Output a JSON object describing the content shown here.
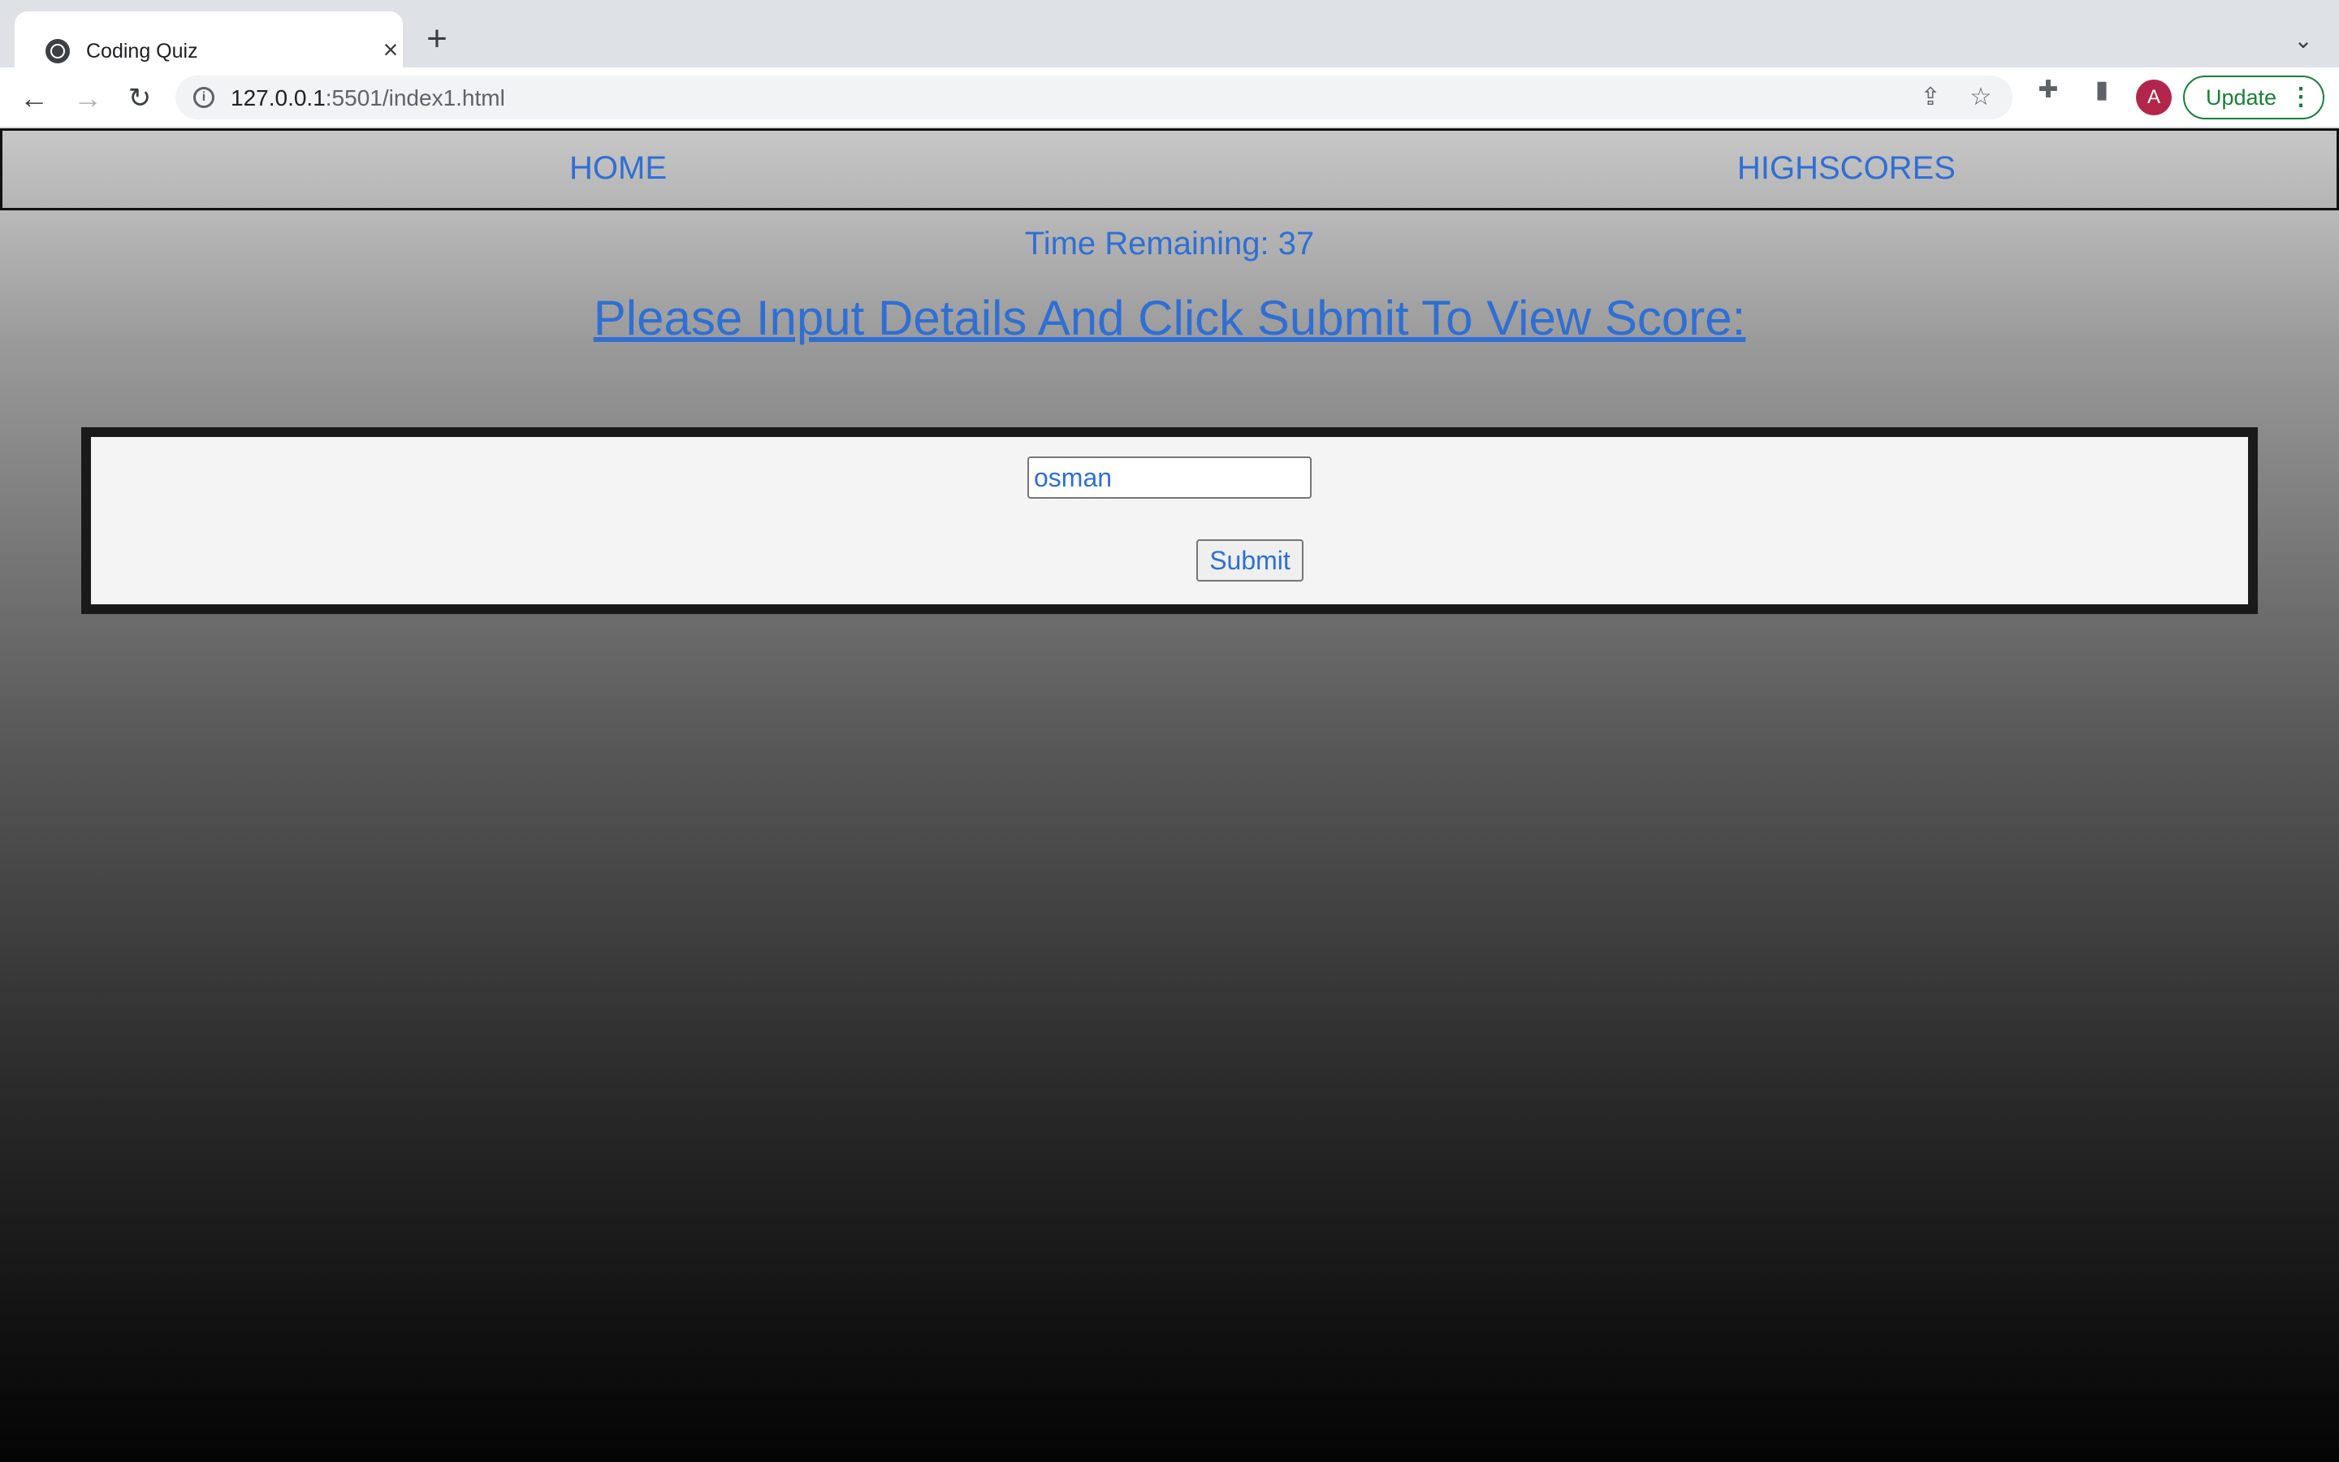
{
  "browser": {
    "tab_title": "Coding Quiz",
    "url_host": "127.0.0.1",
    "url_rest": ":5501/index1.html",
    "avatar_letter": "A",
    "update_label": "Update",
    "icons": {
      "favicon": "globe-icon",
      "close": "close-icon",
      "new_tab": "plus-icon",
      "tab_search": "chevron-down-icon",
      "back": "back-arrow-icon",
      "forward": "forward-arrow-icon",
      "reload": "reload-icon",
      "site_info": "info-icon",
      "share": "share-icon",
      "bookmark": "star-icon",
      "extensions": "puzzle-icon",
      "side_panel": "side-panel-icon",
      "menu": "kebab-menu-icon"
    },
    "colors": {
      "update_accent": "#188038",
      "avatar_bg": "#b3264c"
    }
  },
  "page": {
    "nav": {
      "home": "HOME",
      "highscores": "HIGHSCORES"
    },
    "timer_text": "Time Remaining: 37",
    "prompt": "Please Input Details And Click Submit To View Score:",
    "form": {
      "name_value": "osman",
      "submit_label": "Submit"
    },
    "colors": {
      "text": "#2f6fd4",
      "box_border": "#1a1a1a"
    }
  }
}
